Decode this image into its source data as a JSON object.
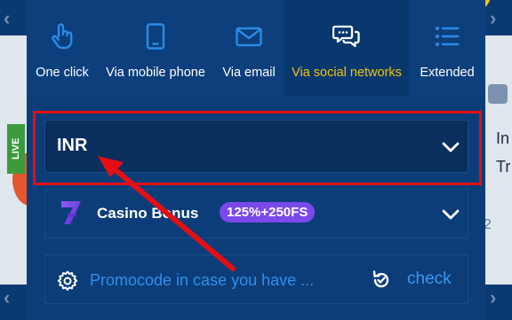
{
  "tabs": [
    {
      "label": "One click",
      "icon": "pointer-hand-icon"
    },
    {
      "label": "Via mobile phone",
      "icon": "tablet-icon"
    },
    {
      "label": "Via email",
      "icon": "envelope-icon"
    },
    {
      "label": "Via social networks",
      "icon": "chat-bubbles-icon",
      "active": true
    },
    {
      "label": "Extended",
      "icon": "list-icon"
    }
  ],
  "currency": {
    "value": "INR"
  },
  "bonus": {
    "label": "Casino Bonus",
    "badge": "125%+250FS"
  },
  "promo": {
    "placeholder": "Promocode in case you have ...",
    "check_label": "check"
  },
  "background": {
    "live_label": "LIVE",
    "side_text_1": "In",
    "side_text_2": "Tr",
    "side_number": "2"
  },
  "colors": {
    "accent_active": "#f2c211",
    "highlight": "#e30f14",
    "badge": "#7b48ea",
    "link": "#3e97ec",
    "modal_bg": "#0c3d79"
  }
}
